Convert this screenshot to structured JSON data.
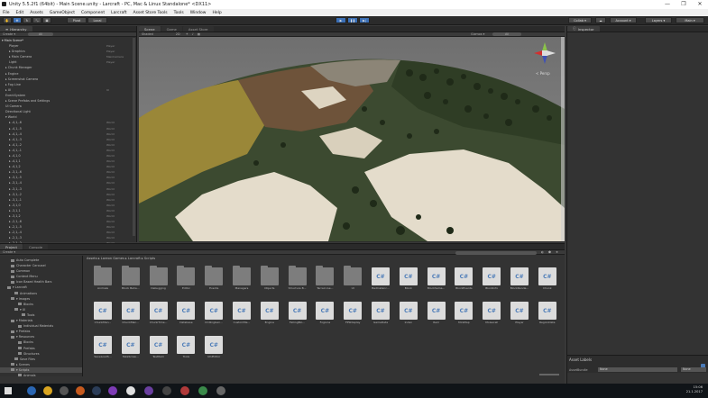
{
  "window": {
    "title": "Unity 5.5.2f1 (64bit) - Main Scene.unity - Larcraft - PC, Mac & Linux Standalone* <DX11>",
    "buttons": [
      "—",
      "❐",
      "✕"
    ]
  },
  "menu": [
    "File",
    "Edit",
    "Assets",
    "GameObject",
    "Component",
    "Larcraft",
    "Asset Store Tools",
    "Tools",
    "Window",
    "Help"
  ],
  "toolbar": {
    "pivot": "Pivot",
    "local": "Local",
    "collab": "Collab ▾",
    "account": "Account ▾",
    "layers": "Layers ▾",
    "layout": "Main ▾"
  },
  "hierarchy": {
    "tab": "Hierarchy",
    "create": "Create ▾",
    "search": "All",
    "rows": [
      {
        "label": "▾ Main Scene*",
        "indent": 0,
        "tag": ""
      },
      {
        "label": "Player",
        "indent": 2,
        "tag": "Player"
      },
      {
        "label": "▸ Graphics",
        "indent": 2,
        "tag": "Player"
      },
      {
        "label": "▸ Main Camera",
        "indent": 2,
        "tag": "MainCamera"
      },
      {
        "label": "Light",
        "indent": 2,
        "tag": "Player"
      },
      {
        "label": "▸ Chunk Manager",
        "indent": 1,
        "tag": ""
      },
      {
        "label": "▸ Engine",
        "indent": 1,
        "tag": ""
      },
      {
        "label": "▸ Screenshot Camera",
        "indent": 1,
        "tag": ""
      },
      {
        "label": "▸ Fog Line",
        "indent": 1,
        "tag": ""
      },
      {
        "label": "▸ UI",
        "indent": 1,
        "tag": "UI"
      },
      {
        "label": "EventSystem",
        "indent": 1,
        "tag": ""
      },
      {
        "label": "▸ Scene Prefabs and Settings",
        "indent": 1,
        "tag": ""
      },
      {
        "label": "UI Camera",
        "indent": 1,
        "tag": ""
      },
      {
        "label": "Directional Light",
        "indent": 1,
        "tag": ""
      },
      {
        "label": "▾ World",
        "indent": 1,
        "tag": ""
      },
      {
        "label": "▸ -4,1,-6",
        "indent": 2,
        "tag": "World"
      },
      {
        "label": "▸ -4,1,-5",
        "indent": 2,
        "tag": "World"
      },
      {
        "label": "▸ -4,1,-4",
        "indent": 2,
        "tag": "World"
      },
      {
        "label": "▸ -4,1,-3",
        "indent": 2,
        "tag": "World"
      },
      {
        "label": "▸ -4,1,-2",
        "indent": 2,
        "tag": "World"
      },
      {
        "label": "▸ -4,1,-1",
        "indent": 2,
        "tag": "World"
      },
      {
        "label": "▸ -4,1,0",
        "indent": 2,
        "tag": "World"
      },
      {
        "label": "▸ -4,1,1",
        "indent": 2,
        "tag": "World"
      },
      {
        "label": "▸ -4,1,2",
        "indent": 2,
        "tag": "World"
      },
      {
        "label": "▸ -3,1,-6",
        "indent": 2,
        "tag": "World"
      },
      {
        "label": "▸ -3,1,-5",
        "indent": 2,
        "tag": "World"
      },
      {
        "label": "▸ -3,1,-4",
        "indent": 2,
        "tag": "World"
      },
      {
        "label": "▸ -3,1,-3",
        "indent": 2,
        "tag": "World"
      },
      {
        "label": "▸ -3,1,-2",
        "indent": 2,
        "tag": "World"
      },
      {
        "label": "▸ -3,1,-1",
        "indent": 2,
        "tag": "World"
      },
      {
        "label": "▸ -3,1,0",
        "indent": 2,
        "tag": "World"
      },
      {
        "label": "▸ -3,1,1",
        "indent": 2,
        "tag": "World"
      },
      {
        "label": "▸ -3,1,2",
        "indent": 2,
        "tag": "World"
      },
      {
        "label": "▸ -2,1,-6",
        "indent": 2,
        "tag": "World"
      },
      {
        "label": "▸ -2,1,-5",
        "indent": 2,
        "tag": "World"
      },
      {
        "label": "▸ -2,1,-4",
        "indent": 2,
        "tag": "World"
      },
      {
        "label": "▸ -2,1,-3",
        "indent": 2,
        "tag": "World"
      },
      {
        "label": "▸ -2,1,-2",
        "indent": 2,
        "tag": "World"
      }
    ]
  },
  "scene": {
    "tabs": [
      "Scene",
      "Game",
      "Asset Store"
    ],
    "shading": "Shaded",
    "mode": "2D",
    "gizmos": "Gizmos ▾",
    "search": "All",
    "persp": "< Persp"
  },
  "inspector": {
    "tab": "Inspector",
    "asset_labels": "Asset Labels",
    "bundle_label": "AssetBundle",
    "bundle_value": "None",
    "variant_value": "None"
  },
  "project": {
    "tabs": [
      "Project",
      "Console"
    ],
    "create": "Create ▾",
    "breadcrumb": "Assets ▸ Lareon Games ▸ Larcraft ▸ Scripts",
    "tree": [
      {
        "label": "Auto Complete",
        "indent": 2
      },
      {
        "label": "Character Carousel",
        "indent": 2
      },
      {
        "label": "Common",
        "indent": 2
      },
      {
        "label": "Context Menu",
        "indent": 2
      },
      {
        "label": "Icon Based Health Bars",
        "indent": 2
      },
      {
        "label": "▾ Larcraft",
        "indent": 1
      },
      {
        "label": "Animations",
        "indent": 3
      },
      {
        "label": "▾ Images",
        "indent": 2
      },
      {
        "label": "Blocks",
        "indent": 4
      },
      {
        "label": "▾ UI",
        "indent": 3
      },
      {
        "label": "Tools",
        "indent": 5
      },
      {
        "label": "▾ Materials",
        "indent": 2
      },
      {
        "label": "Individual Materials",
        "indent": 4
      },
      {
        "label": "▾ Prefabs",
        "indent": 2
      },
      {
        "label": "▾ Resources",
        "indent": 2
      },
      {
        "label": "Blocks",
        "indent": 4
      },
      {
        "label": "Prefabs",
        "indent": 4
      },
      {
        "label": "Structures",
        "indent": 4
      },
      {
        "label": "Save Files",
        "indent": 3
      },
      {
        "label": "▸ Scenes",
        "indent": 2
      },
      {
        "label": "▾ Scripts",
        "indent": 2
      },
      {
        "label": "Animals",
        "indent": 4
      }
    ],
    "assets": [
      {
        "name": "Animals",
        "kind": "folder"
      },
      {
        "name": "Block Beha...",
        "kind": "folder"
      },
      {
        "name": "Debugging",
        "kind": "folder"
      },
      {
        "name": "Editor",
        "kind": "folder"
      },
      {
        "name": "Events",
        "kind": "folder"
      },
      {
        "name": "Managers",
        "kind": "folder"
      },
      {
        "name": "Objects",
        "kind": "folder"
      },
      {
        "name": "Structure B...",
        "kind": "folder"
      },
      {
        "name": "Terrain Ge...",
        "kind": "folder"
      },
      {
        "name": "UI",
        "kind": "folder"
      },
      {
        "name": "BadInstanc...",
        "kind": "cs"
      },
      {
        "name": "Block",
        "kind": "cs"
      },
      {
        "name": "BlockSama...",
        "kind": "cs"
      },
      {
        "name": "BlockEvents",
        "kind": "cs"
      },
      {
        "name": "BlockInfo",
        "kind": "cs"
      },
      {
        "name": "BlockRende...",
        "kind": "cs"
      },
      {
        "name": "Chunk",
        "kind": "cs"
      },
      {
        "name": "ChunkMan...",
        "kind": "cs"
      },
      {
        "name": "ChunkMan...",
        "kind": "cs"
      },
      {
        "name": "ChunkTime...",
        "kind": "cs"
      },
      {
        "name": "Database",
        "kind": "cs"
      },
      {
        "name": "DrillingGen...",
        "kind": "cs"
      },
      {
        "name": "CustomMe...",
        "kind": "cs"
      },
      {
        "name": "Engine",
        "kind": "cs"
      },
      {
        "name": "FallingBlo...",
        "kind": "cs"
      },
      {
        "name": "FogLine",
        "kind": "cs"
      },
      {
        "name": "FPSDisplay",
        "kind": "cs"
      },
      {
        "name": "GameData",
        "kind": "cs"
      },
      {
        "name": "Index",
        "kind": "cs"
      },
      {
        "name": "Item",
        "kind": "cs"
      },
      {
        "name": "MiniMap",
        "kind": "cs"
      },
      {
        "name": "Moisecell",
        "kind": "cs"
      },
      {
        "name": "Player",
        "kind": "cs"
      },
      {
        "name": "RegionData",
        "kind": "cs"
      },
      {
        "name": "SaveLoadS...",
        "kind": "cs"
      },
      {
        "name": "TakeScree...",
        "kind": "cs"
      },
      {
        "name": "TestItem",
        "kind": "cs"
      },
      {
        "name": "Tools",
        "kind": "cs"
      },
      {
        "name": "UIUEditor",
        "kind": "cs"
      }
    ]
  },
  "taskbar": {
    "time": "15:06",
    "date": "21.1.2017"
  },
  "colors": {
    "grass": "#3a4a2e",
    "sand": "#e6dfcf",
    "dirt": "#7a5a3c",
    "yellow_grass": "#9c8a3a",
    "sky": "#8a8a8a",
    "accent_blue": "#3b6fb5"
  }
}
